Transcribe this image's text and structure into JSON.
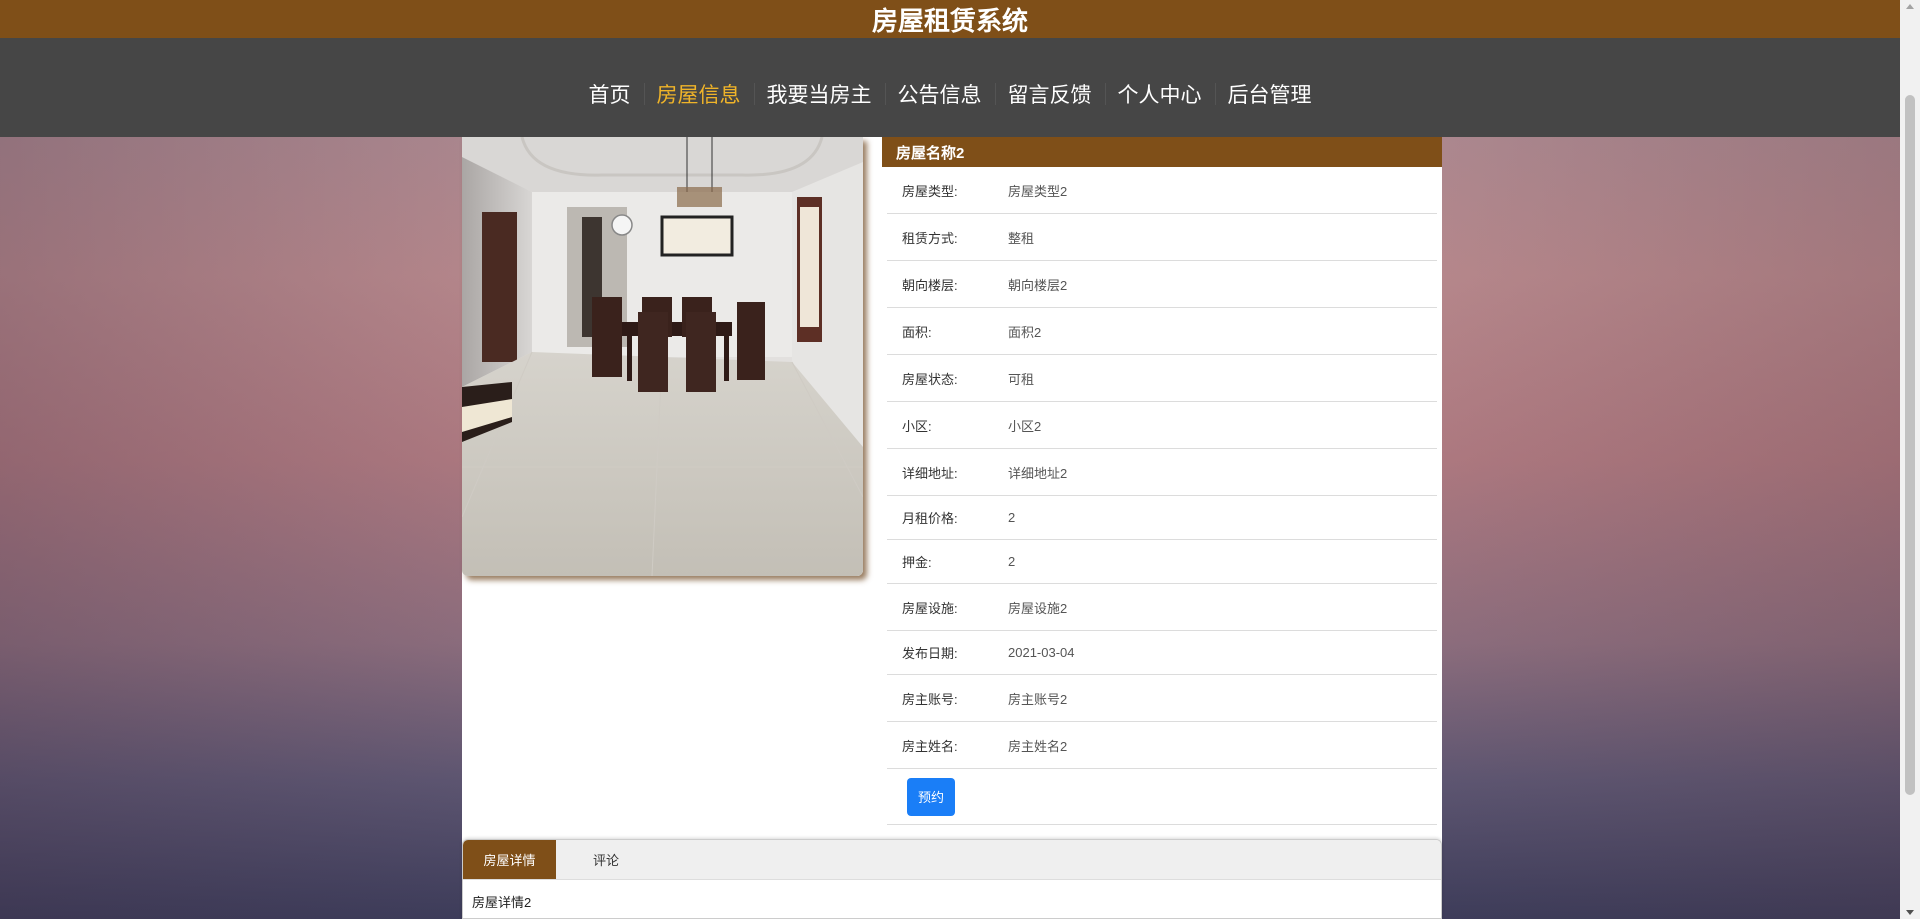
{
  "app": {
    "title": "房屋租赁系统"
  },
  "nav": {
    "items": [
      {
        "label": "首页",
        "active": false
      },
      {
        "label": "房屋信息",
        "active": true
      },
      {
        "label": "我要当房主",
        "active": false
      },
      {
        "label": "公告信息",
        "active": false
      },
      {
        "label": "留言反馈",
        "active": false
      },
      {
        "label": "个人中心",
        "active": false
      },
      {
        "label": "后台管理",
        "active": false
      }
    ]
  },
  "house": {
    "name": "房屋名称2",
    "fields": [
      {
        "label": "房屋类型:",
        "value": "房屋类型2"
      },
      {
        "label": "租赁方式:",
        "value": "整租"
      },
      {
        "label": "朝向楼层:",
        "value": "朝向楼层2"
      },
      {
        "label": "面积:",
        "value": "面积2"
      },
      {
        "label": "房屋状态:",
        "value": "可租"
      },
      {
        "label": "小区:",
        "value": "小区2"
      },
      {
        "label": "详细地址:",
        "value": "详细地址2"
      },
      {
        "label": "月租价格:",
        "value": "2"
      },
      {
        "label": "押金:",
        "value": "2"
      },
      {
        "label": "房屋设施:",
        "value": "房屋设施2"
      },
      {
        "label": "发布日期:",
        "value": "2021-03-04"
      },
      {
        "label": "房主账号:",
        "value": "房主账号2"
      },
      {
        "label": "房主姓名:",
        "value": "房主姓名2"
      }
    ],
    "book_label": "预约"
  },
  "tabs": {
    "items": [
      {
        "label": "房屋详情",
        "active": true
      },
      {
        "label": "评论",
        "active": false
      }
    ],
    "content": "房屋详情2"
  },
  "colors": {
    "brand": "#7f4f18",
    "nav_bg": "#464646",
    "nav_active": "#f0b429",
    "button": "#1a7ef7"
  }
}
